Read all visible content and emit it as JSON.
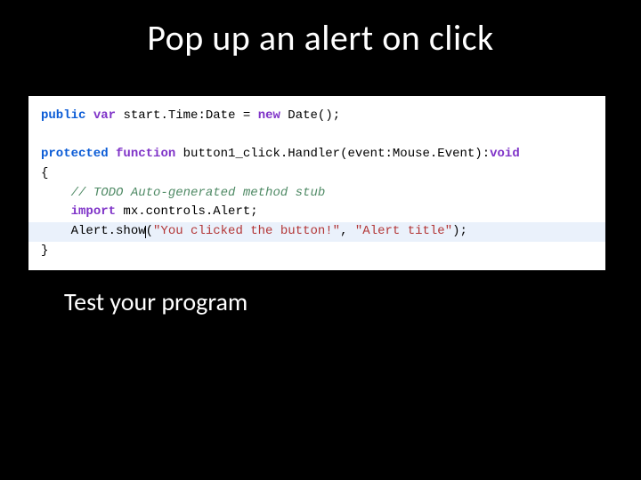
{
  "title": "Pop up an alert on click",
  "caption": "Test your program",
  "code": {
    "l1": {
      "kw_public": "public",
      "kw_var": "var",
      "rest": " start.Time:Date = ",
      "kw_new": "new",
      "rest2": " Date();"
    },
    "blank": " ",
    "l2": {
      "kw_protected": "protected",
      "kw_function": "function",
      "rest": " button1_click.Handler(event:Mouse.Event):",
      "kw_void": "void"
    },
    "brace_open": "{",
    "l3_indent": "    ",
    "l3_comment": "// TODO Auto-generated method stub",
    "l4_indent": "    ",
    "l4_kw_import": "import",
    "l4_rest": " mx.controls.Alert;",
    "l5_indent": "    ",
    "l5_pre": "Alert.show",
    "l5_paren": "(",
    "l5_str1": "\"You clicked the button!\"",
    "l5_comma": ", ",
    "l5_str2": "\"Alert title\"",
    "l5_end": ");",
    "brace_close": "}"
  }
}
